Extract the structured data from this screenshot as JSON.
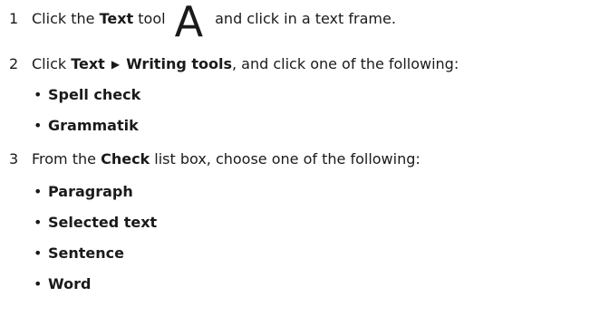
{
  "steps": [
    {
      "number": "1",
      "prefix": "Click the ",
      "bold1": "Text",
      "middle": " tool",
      "tool_icon_glyph": "A",
      "suffix": " and click in a text frame."
    },
    {
      "number": "2",
      "prefix": "Click ",
      "menu": "Text",
      "arrow_glyph": "▶",
      "submenu": "Writing tools",
      "suffix": ", and click one of the following:",
      "options": [
        "Spell check",
        "Grammatik"
      ]
    },
    {
      "number": "3",
      "prefix": "From the ",
      "bold1": "Check",
      "suffix": " list box, choose one of the following:",
      "options": [
        "Paragraph",
        "Selected text",
        "Sentence",
        "Word"
      ]
    }
  ],
  "bullet_glyph": "•"
}
